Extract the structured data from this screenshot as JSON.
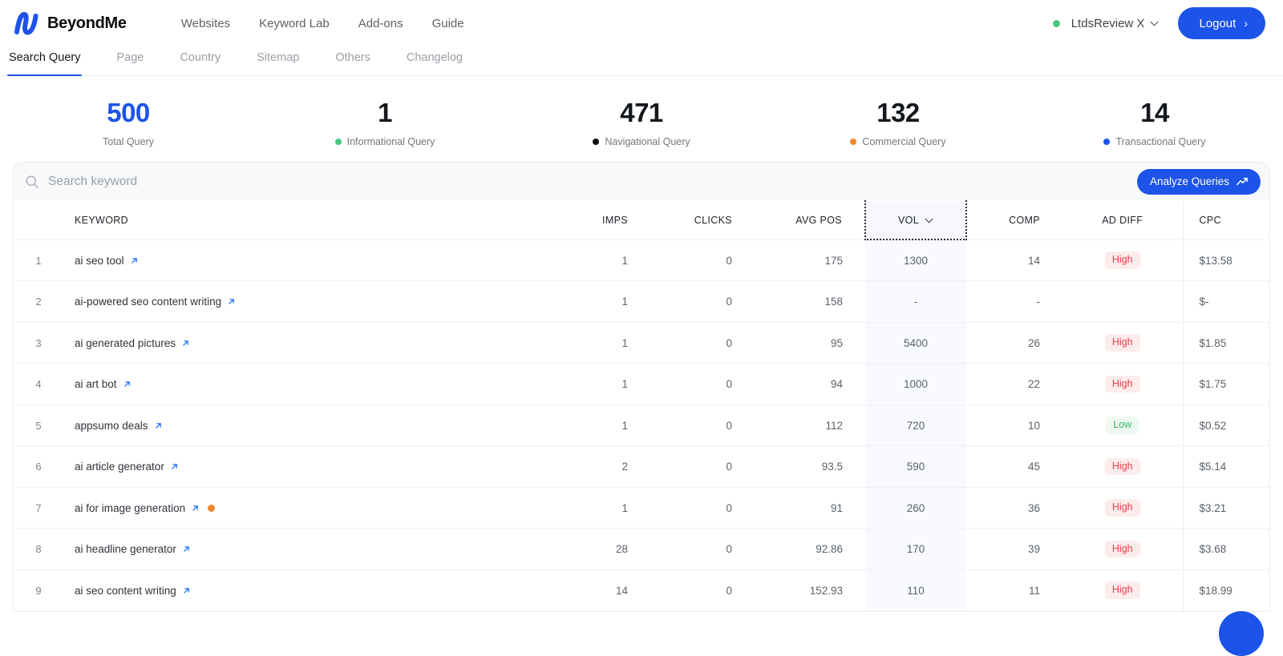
{
  "header": {
    "brand": "BeyondMe",
    "logo_icon": "beyondme-logo-icon",
    "nav": [
      {
        "label": "Websites"
      },
      {
        "label": "Keyword Lab"
      },
      {
        "label": "Add-ons"
      },
      {
        "label": "Guide"
      }
    ],
    "status_dot_color": "#4ac77e",
    "account_name": "LtdsReview X",
    "account_chevron_icon": "chevron-down-icon",
    "logout_label": "Logout",
    "logout_arrow": "›",
    "accent_color": "#1c53e8"
  },
  "tabs": [
    {
      "label": "Search Query",
      "active": true
    },
    {
      "label": "Page",
      "active": false
    },
    {
      "label": "Country",
      "active": false
    },
    {
      "label": "Sitemap",
      "active": false
    },
    {
      "label": "Others",
      "active": false
    },
    {
      "label": "Changelog",
      "active": false
    }
  ],
  "stats": [
    {
      "value": "500",
      "label": "Total Query",
      "dot": null,
      "accent": true
    },
    {
      "value": "1",
      "label": "Informational Query",
      "dot": "#4ac77e",
      "accent": false
    },
    {
      "value": "471",
      "label": "Navigational Query",
      "dot": "#101114",
      "accent": false
    },
    {
      "value": "132",
      "label": "Commercial Query",
      "dot": "#f08a2e",
      "accent": false
    },
    {
      "value": "14",
      "label": "Transactional Query",
      "dot": "#1c53e8",
      "accent": false
    }
  ],
  "search": {
    "placeholder": "Search keyword",
    "value": "",
    "icon": "search-icon",
    "analyze_label": "Analyze Queries",
    "analyze_icon": "trending-up-icon"
  },
  "table": {
    "columns": [
      {
        "key": "idx",
        "label": ""
      },
      {
        "key": "keyword",
        "label": "KEYWORD"
      },
      {
        "key": "imps",
        "label": "IMPS"
      },
      {
        "key": "clicks",
        "label": "CLICKS"
      },
      {
        "key": "avg_pos",
        "label": "AVG POS"
      },
      {
        "key": "vol",
        "label": "VOL",
        "sorted": true,
        "sort_icon": "chevron-down-icon"
      },
      {
        "key": "comp",
        "label": "COMP"
      },
      {
        "key": "ad_diff",
        "label": "AD DIFF"
      },
      {
        "key": "cpc",
        "label": "CPC"
      }
    ],
    "rows": [
      {
        "idx": "1",
        "keyword": "ai seo tool",
        "link_icon": "external-link-icon",
        "dot": null,
        "imps": "1",
        "clicks": "0",
        "avg_pos": "175",
        "vol": "1300",
        "comp": "14",
        "ad_diff": "High",
        "ad_diff_level": "high",
        "cpc": "$13.58"
      },
      {
        "idx": "2",
        "keyword": "ai-powered seo content writing",
        "link_icon": "external-link-icon",
        "dot": null,
        "imps": "1",
        "clicks": "0",
        "avg_pos": "158",
        "vol": "-",
        "comp": "-",
        "ad_diff": "",
        "ad_diff_level": "none",
        "cpc": "$-"
      },
      {
        "idx": "3",
        "keyword": "ai generated pictures",
        "link_icon": "external-link-icon",
        "dot": null,
        "imps": "1",
        "clicks": "0",
        "avg_pos": "95",
        "vol": "5400",
        "comp": "26",
        "ad_diff": "High",
        "ad_diff_level": "high",
        "cpc": "$1.85"
      },
      {
        "idx": "4",
        "keyword": "ai art bot",
        "link_icon": "external-link-icon",
        "dot": null,
        "imps": "1",
        "clicks": "0",
        "avg_pos": "94",
        "vol": "1000",
        "comp": "22",
        "ad_diff": "High",
        "ad_diff_level": "high",
        "cpc": "$1.75"
      },
      {
        "idx": "5",
        "keyword": "appsumo deals",
        "link_icon": "external-link-icon",
        "dot": null,
        "imps": "1",
        "clicks": "0",
        "avg_pos": "112",
        "vol": "720",
        "comp": "10",
        "ad_diff": "Low",
        "ad_diff_level": "low",
        "cpc": "$0.52"
      },
      {
        "idx": "6",
        "keyword": "ai article generator",
        "link_icon": "external-link-icon",
        "dot": null,
        "imps": "2",
        "clicks": "0",
        "avg_pos": "93.5",
        "vol": "590",
        "comp": "45",
        "ad_diff": "High",
        "ad_diff_level": "high",
        "cpc": "$5.14"
      },
      {
        "idx": "7",
        "keyword": "ai for image generation",
        "link_icon": "external-link-icon",
        "dot": "#f08a2e",
        "imps": "1",
        "clicks": "0",
        "avg_pos": "91",
        "vol": "260",
        "comp": "36",
        "ad_diff": "High",
        "ad_diff_level": "high",
        "cpc": "$3.21"
      },
      {
        "idx": "8",
        "keyword": "ai headline generator",
        "link_icon": "external-link-icon",
        "dot": null,
        "imps": "28",
        "clicks": "0",
        "avg_pos": "92.86",
        "vol": "170",
        "comp": "39",
        "ad_diff": "High",
        "ad_diff_level": "high",
        "cpc": "$3.68"
      },
      {
        "idx": "9",
        "keyword": "ai seo content writing",
        "link_icon": "external-link-icon",
        "dot": null,
        "imps": "14",
        "clicks": "0",
        "avg_pos": "152.93",
        "vol": "110",
        "comp": "11",
        "ad_diff": "High",
        "ad_diff_level": "high",
        "cpc": "$18.99"
      }
    ]
  },
  "fab": {
    "icon": "chat-bubble-icon",
    "color": "#1c53e8"
  }
}
